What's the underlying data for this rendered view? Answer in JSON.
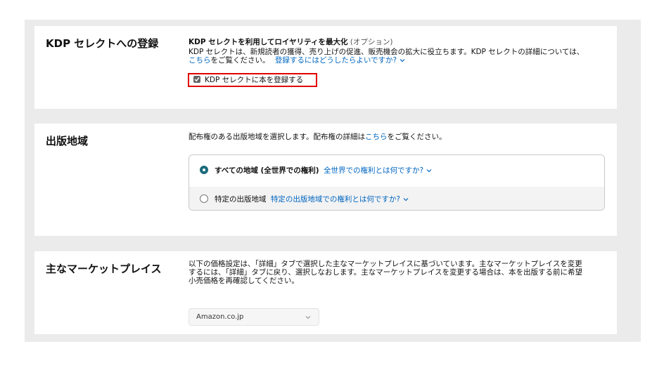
{
  "kdp_select": {
    "title": "KDP セレクトへの登録",
    "heading": "KDP セレクトを利用してロイヤリティを最大化",
    "optional": "(オプション)",
    "desc": "KDP セレクトは、新規読者の獲得、売り上げの促進、販売機会の拡大に役立ちます。KDP セレクトの詳細については、",
    "details_link": "こちら",
    "details_suffix": "をご覧ください。",
    "how_to_link": "登録するにはどうしたらよいですか?",
    "checkbox_label": "KDP セレクトに本を登録する",
    "checkbox_checked": true
  },
  "territories": {
    "title": "出版地域",
    "desc_prefix": "配布権のある出版地域を選択します。配布権の詳細は",
    "desc_link": "こちら",
    "desc_suffix": "をご覧ください。",
    "options": [
      {
        "label": "すべての地域 (全世界での権利)",
        "help_link": "全世界での権利とは何ですか?",
        "selected": true
      },
      {
        "label": "特定の出版地域",
        "help_link": "特定の出版地域での権利とは何ですか?",
        "selected": false
      }
    ]
  },
  "marketplace": {
    "title": "主なマーケットプレイス",
    "desc_lines": [
      "以下の価格設定は、「詳細」タブで選択した主なマーケットプレイスに基づいています。主なマーケットプレイスを変更",
      "するには、「詳細」タブに戻り、選択しなおします。主なマーケットプレイスを変更する場合は、本を出版する前に希望",
      "小売価格を再確認してください。"
    ],
    "selected": "Amazon.co.jp"
  },
  "colors": {
    "link": "#0066c0",
    "highlight": "#e00000",
    "radio_selected": "#1b6b7b",
    "background": "#ebebeb"
  },
  "icons": {
    "chevron": "chevron-down-icon",
    "checkbox": "checkmark-icon"
  }
}
